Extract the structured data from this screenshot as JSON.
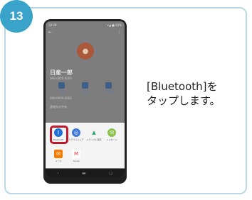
{
  "step": {
    "number": "13"
  },
  "instruction": {
    "line1": "[Bluetooth]を",
    "line2": "タップします。"
  },
  "phone": {
    "status_time": "10:28",
    "status_right": "▾◢ ■ 83%",
    "contact": {
      "name": "日産一郎",
      "subtitle": "090-0000-0000"
    },
    "actions": [
      {
        "label": "通話",
        "icon": "phone-icon"
      },
      {
        "label": "SMS",
        "icon": "message-icon"
      },
      {
        "label": "ビデオ通話",
        "icon": "video-icon"
      }
    ],
    "info_rows": [
      "090-0000-0000",
      "連絡先の共有"
    ],
    "share_apps_row1": [
      {
        "label": "Bluetooth",
        "icon": "bluetooth-icon",
        "color": "#1e6fd9"
      },
      {
        "label": "ニアバイシェア",
        "icon": "nearby-share-icon",
        "color": "#3c78d8"
      },
      {
        "label": "ドライブに保存",
        "icon": "drive-icon",
        "color": "#f2f2f2"
      },
      {
        "label": "メッセージ",
        "icon": "messages-icon",
        "color": "#8bc34a"
      }
    ],
    "share_apps_row2": [
      {
        "label": "メール",
        "icon": "email-icon",
        "color": "#f57c00"
      },
      {
        "label": "Gmail",
        "icon": "gmail-icon",
        "color": "#ffffff"
      }
    ],
    "highlight_color": "#c2182b"
  },
  "colors": {
    "accent": "#3aa3ca",
    "border": "#b9d8e6"
  }
}
